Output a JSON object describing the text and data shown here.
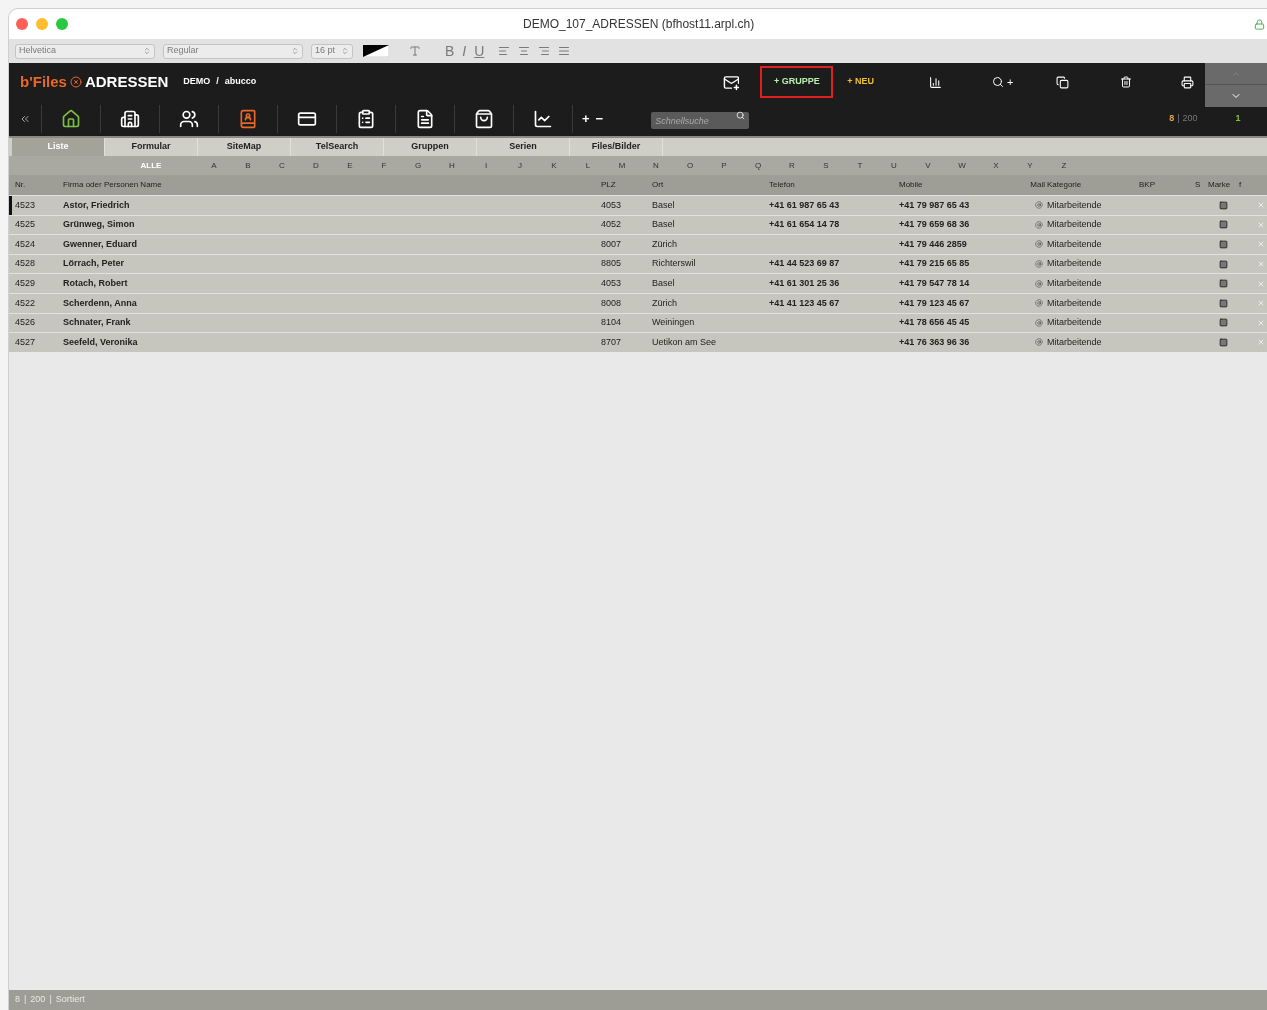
{
  "window": {
    "title": "DEMO_107_ADRESSEN (bfhost11.arpl.ch)"
  },
  "format_bar": {
    "font": "Helvetica",
    "style": "Regular",
    "size": "16 pt",
    "bold": "B",
    "italic": "I",
    "underline": "U",
    "disabled": true
  },
  "header": {
    "brand": "b'Files",
    "module": "ADRESSEN",
    "database": "DEMO",
    "separator": "/",
    "user": "abucco",
    "group_button": {
      "label": "+ GRUPPE",
      "highlighted": true
    },
    "new_button": {
      "label": "+ NEU"
    },
    "search_add": "+"
  },
  "toolbar": {
    "icons": [
      {
        "kind": "back",
        "selected": false
      },
      {
        "kind": "home",
        "selected": false
      },
      {
        "kind": "building",
        "selected": false
      },
      {
        "kind": "people",
        "selected": false
      },
      {
        "kind": "addressbook",
        "selected": true
      },
      {
        "kind": "card",
        "selected": false
      },
      {
        "kind": "clipboard",
        "selected": false
      },
      {
        "kind": "document",
        "selected": false
      },
      {
        "kind": "bag",
        "selected": false
      },
      {
        "kind": "chart",
        "selected": false
      }
    ],
    "plus": "+",
    "minus": "−",
    "search": {
      "placeholder": "Schnellsuche"
    },
    "found": "8",
    "separator": "|",
    "total": "200",
    "page": "1"
  },
  "tabs": [
    {
      "label": "Liste",
      "selected": true
    },
    {
      "label": "Formular",
      "selected": false
    },
    {
      "label": "SiteMap",
      "selected": false
    },
    {
      "label": "TelSearch",
      "selected": false
    },
    {
      "label": "Gruppen",
      "selected": false
    },
    {
      "label": "Serien",
      "selected": false
    },
    {
      "label": "Files/Bilder",
      "selected": false
    }
  ],
  "alphabet": [
    {
      "label": "ALLE",
      "selected": true
    },
    {
      "label": "A",
      "selected": false
    },
    {
      "label": "B",
      "selected": false
    },
    {
      "label": "C",
      "selected": false
    },
    {
      "label": "D",
      "selected": false
    },
    {
      "label": "E",
      "selected": false
    },
    {
      "label": "F",
      "selected": false
    },
    {
      "label": "G",
      "selected": false
    },
    {
      "label": "H",
      "selected": false
    },
    {
      "label": "I",
      "selected": false
    },
    {
      "label": "J",
      "selected": false
    },
    {
      "label": "K",
      "selected": false
    },
    {
      "label": "L",
      "selected": false
    },
    {
      "label": "M",
      "selected": false
    },
    {
      "label": "N",
      "selected": false
    },
    {
      "label": "O",
      "selected": false
    },
    {
      "label": "P",
      "selected": false
    },
    {
      "label": "Q",
      "selected": false
    },
    {
      "label": "R",
      "selected": false
    },
    {
      "label": "S",
      "selected": false
    },
    {
      "label": "T",
      "selected": false
    },
    {
      "label": "U",
      "selected": false
    },
    {
      "label": "V",
      "selected": false
    },
    {
      "label": "W",
      "selected": false
    },
    {
      "label": "X",
      "selected": false
    },
    {
      "label": "Y",
      "selected": false
    },
    {
      "label": "Z",
      "selected": false
    }
  ],
  "table": {
    "columns": [
      "Nr.",
      "Firma oder Personen Name",
      "PLZ",
      "Ort",
      "Telefon",
      "Mobile",
      "Mail",
      "Kategorie",
      "BKP",
      "S",
      "Marke",
      "f"
    ],
    "rows": [
      {
        "nr": "4523",
        "name": "Astor, Friedrich",
        "plz": "4053",
        "ort": "Basel",
        "telefon": "+41 61 987 65 43",
        "mobile": "+41 79 987 65 43",
        "kategorie": "Mitarbeitende",
        "selected": true
      },
      {
        "nr": "4525",
        "name": "Grünweg, Simon",
        "plz": "4052",
        "ort": "Basel",
        "telefon": "+41 61 654 14 78",
        "mobile": "+41 79 659 68 36",
        "kategorie": "Mitarbeitende",
        "selected": false
      },
      {
        "nr": "4524",
        "name": "Gwenner, Eduard",
        "plz": "8007",
        "ort": "Zürich",
        "mobile": "+41 79 446 2859",
        "kategorie": "Mitarbeitende",
        "selected": false
      },
      {
        "nr": "4528",
        "name": "Lörrach, Peter",
        "plz": "8805",
        "ort": "Richterswil",
        "telefon": "+41 44 523 69 87",
        "mobile": "+41 79 215 65 85",
        "kategorie": "Mitarbeitende",
        "selected": false
      },
      {
        "nr": "4529",
        "name": "Rotach, Robert",
        "plz": "4053",
        "ort": "Basel",
        "telefon": "+41 61 301 25 36",
        "mobile": "+41 79 547 78 14",
        "kategorie": "Mitarbeitende",
        "selected": false
      },
      {
        "nr": "4522",
        "name": "Scherdenn, Anna",
        "plz": "8008",
        "ort": "Zürich",
        "telefon": "+41 41 123 45 67",
        "mobile": "+41 79 123 45 67",
        "kategorie": "Mitarbeitende",
        "selected": false
      },
      {
        "nr": "4526",
        "name": "Schnater, Frank",
        "plz": "8104",
        "ort": "Weiningen",
        "mobile": "+41 78 656 45 45",
        "kategorie": "Mitarbeitende",
        "selected": false
      },
      {
        "nr": "4527",
        "name": "Seefeld, Veronika",
        "plz": "8707",
        "ort": "Uetikon am See",
        "mobile": "+41 76 363 96 36",
        "kategorie": "Mitarbeitende",
        "selected": false
      }
    ]
  },
  "status_bar": {
    "found": "8",
    "separator1": "|",
    "total": "200",
    "separator2": "|",
    "sort": "Sortiert"
  }
}
